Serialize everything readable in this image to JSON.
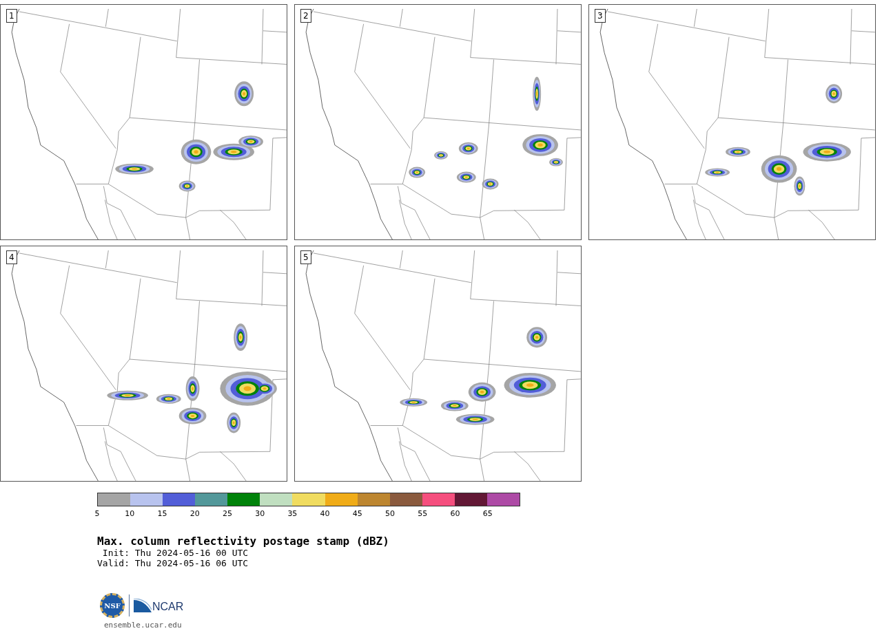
{
  "panels": [
    {
      "label": "1"
    },
    {
      "label": "2"
    },
    {
      "label": "3"
    },
    {
      "label": "4"
    },
    {
      "label": "5"
    }
  ],
  "colorbar": {
    "segments": [
      {
        "color": "#a5a5a5"
      },
      {
        "color": "#b8c3ee"
      },
      {
        "color": "#525ed8"
      },
      {
        "color": "#53989a"
      },
      {
        "color": "#00820a"
      },
      {
        "color": "#c0dfc0"
      },
      {
        "color": "#f0dc60"
      },
      {
        "color": "#f0ac18"
      },
      {
        "color": "#bd8630"
      },
      {
        "color": "#8a5a3e"
      },
      {
        "color": "#f54f7e"
      },
      {
        "color": "#621835"
      },
      {
        "color": "#ad4aa5"
      }
    ],
    "ticks": [
      "5",
      "10",
      "15",
      "20",
      "25",
      "30",
      "35",
      "40",
      "45",
      "50",
      "55",
      "60",
      "65"
    ]
  },
  "title": "Max. column reflectivity postage stamp (dBZ)",
  "init": " Init: Thu 2024-05-16 00 UTC",
  "valid": "Valid: Thu 2024-05-16 06 UTC",
  "logo": {
    "seal_text": "NSF",
    "wordmark": "NCAR"
  },
  "url": "ensemble.ucar.edu"
}
